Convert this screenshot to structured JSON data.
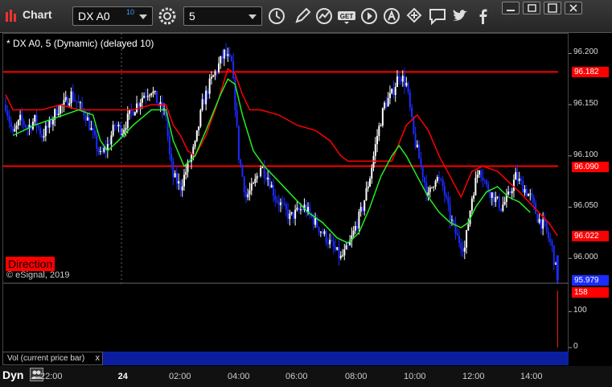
{
  "window": {
    "title": "Chart"
  },
  "toolbar": {
    "symbol": "DX A0",
    "symbol_superscript": "10",
    "interval": "5"
  },
  "chart": {
    "legend": "* DX A0, 5 (Dynamic) (delayed 10)",
    "direction_label": "Direction",
    "copyright": "© eSignal, 2019",
    "price_axis": [
      "96.200",
      "96.150",
      "96.100",
      "96.050",
      "96.000"
    ],
    "price_boxes": [
      {
        "value": "96.182",
        "color": "#ff0000"
      },
      {
        "value": "96.090",
        "color": "#ff0000"
      },
      {
        "value": "96.022",
        "color": "#ff0000"
      },
      {
        "value": "95.979",
        "color": "#1a2cff"
      }
    ],
    "volume_axis": [
      "100",
      "0"
    ],
    "volume_box": "158",
    "volume_label": "Vol (current price bar)",
    "volume_close": "x",
    "time_axis": [
      {
        "label": "22:00",
        "bold": false
      },
      {
        "label": "24",
        "bold": true
      },
      {
        "label": "02:00",
        "bold": false
      },
      {
        "label": "04:00",
        "bold": false
      },
      {
        "label": "06:00",
        "bold": false
      },
      {
        "label": "08:00",
        "bold": false
      },
      {
        "label": "10:00",
        "bold": false
      },
      {
        "label": "12:00",
        "bold": false
      },
      {
        "label": "14:00",
        "bold": false
      }
    ],
    "dyn_label": "Dyn"
  },
  "chart_data": {
    "type": "candlestick",
    "y_range": [
      95.975,
      96.22
    ],
    "levels": [
      96.182,
      96.09
    ],
    "series": [
      {
        "name": "",
        "color": "#ff0000",
        "kind": "line"
      },
      {
        "name": "",
        "color": "#22ee22",
        "kind": "line"
      }
    ],
    "price_path": [
      [
        0,
        96.15
      ],
      [
        4,
        96.12
      ],
      [
        8,
        96.135
      ],
      [
        12,
        96.128
      ],
      [
        16,
        96.135
      ],
      [
        20,
        96.12
      ],
      [
        24,
        96.13
      ],
      [
        28,
        96.145
      ],
      [
        32,
        96.15
      ],
      [
        36,
        96.16
      ],
      [
        40,
        96.15
      ],
      [
        44,
        96.14
      ],
      [
        48,
        96.12
      ],
      [
        52,
        96.1
      ],
      [
        56,
        96.11
      ],
      [
        60,
        96.13
      ],
      [
        64,
        96.125
      ],
      [
        68,
        96.14
      ],
      [
        72,
        96.15
      ],
      [
        76,
        96.16
      ],
      [
        80,
        96.165
      ],
      [
        84,
        96.15
      ],
      [
        88,
        96.14
      ],
      [
        90,
        96.1
      ],
      [
        92,
        96.08
      ],
      [
        96,
        96.07
      ],
      [
        100,
        96.09
      ],
      [
        104,
        96.11
      ],
      [
        108,
        96.15
      ],
      [
        112,
        96.17
      ],
      [
        116,
        96.185
      ],
      [
        120,
        96.2
      ],
      [
        124,
        96.19
      ],
      [
        126,
        96.15
      ],
      [
        128,
        96.1
      ],
      [
        132,
        96.06
      ],
      [
        136,
        96.07
      ],
      [
        140,
        96.09
      ],
      [
        144,
        96.08
      ],
      [
        148,
        96.06
      ],
      [
        152,
        96.05
      ],
      [
        156,
        96.04
      ],
      [
        160,
        96.045
      ],
      [
        164,
        96.05
      ],
      [
        168,
        96.04
      ],
      [
        172,
        96.03
      ],
      [
        176,
        96.02
      ],
      [
        180,
        96.01
      ],
      [
        184,
        96.0
      ],
      [
        188,
        96.01
      ],
      [
        192,
        96.03
      ],
      [
        196,
        96.05
      ],
      [
        200,
        96.08
      ],
      [
        204,
        96.12
      ],
      [
        208,
        96.15
      ],
      [
        212,
        96.16
      ],
      [
        216,
        96.18
      ],
      [
        220,
        96.17
      ],
      [
        224,
        96.12
      ],
      [
        228,
        96.09
      ],
      [
        232,
        96.06
      ],
      [
        236,
        96.08
      ],
      [
        240,
        96.07
      ],
      [
        244,
        96.04
      ],
      [
        248,
        96.02
      ],
      [
        252,
        96.01
      ],
      [
        256,
        96.06
      ],
      [
        260,
        96.09
      ],
      [
        264,
        96.07
      ],
      [
        268,
        96.06
      ],
      [
        272,
        96.05
      ],
      [
        276,
        96.06
      ],
      [
        280,
        96.08
      ],
      [
        284,
        96.07
      ],
      [
        288,
        96.06
      ],
      [
        292,
        96.04
      ],
      [
        296,
        96.03
      ],
      [
        300,
        96.01
      ],
      [
        303,
        95.979
      ]
    ],
    "red_line": [
      [
        0,
        96.16
      ],
      [
        4,
        96.145
      ],
      [
        12,
        96.145
      ],
      [
        20,
        96.145
      ],
      [
        30,
        96.15
      ],
      [
        40,
        96.145
      ],
      [
        50,
        96.145
      ],
      [
        60,
        96.145
      ],
      [
        70,
        96.145
      ],
      [
        80,
        96.15
      ],
      [
        88,
        96.15
      ],
      [
        92,
        96.13
      ],
      [
        96,
        96.12
      ],
      [
        100,
        96.105
      ],
      [
        104,
        96.1
      ],
      [
        110,
        96.12
      ],
      [
        116,
        96.15
      ],
      [
        122,
        96.185
      ],
      [
        126,
        96.18
      ],
      [
        130,
        96.16
      ],
      [
        134,
        96.145
      ],
      [
        140,
        96.145
      ],
      [
        150,
        96.14
      ],
      [
        160,
        96.13
      ],
      [
        170,
        96.125
      ],
      [
        178,
        96.115
      ],
      [
        184,
        96.1
      ],
      [
        188,
        96.095
      ],
      [
        200,
        96.095
      ],
      [
        212,
        96.095
      ],
      [
        220,
        96.13
      ],
      [
        226,
        96.14
      ],
      [
        232,
        96.125
      ],
      [
        238,
        96.1
      ],
      [
        244,
        96.08
      ],
      [
        250,
        96.06
      ],
      [
        256,
        96.085
      ],
      [
        262,
        96.09
      ],
      [
        270,
        96.085
      ],
      [
        276,
        96.075
      ],
      [
        282,
        96.065
      ],
      [
        290,
        96.05
      ],
      [
        298,
        96.035
      ],
      [
        303,
        96.022
      ]
    ],
    "green_line": [
      [
        4,
        96.12
      ],
      [
        10,
        96.125
      ],
      [
        16,
        96.13
      ],
      [
        24,
        96.135
      ],
      [
        32,
        96.14
      ],
      [
        40,
        96.145
      ],
      [
        48,
        96.14
      ],
      [
        52,
        96.115
      ],
      [
        56,
        96.105
      ],
      [
        62,
        96.115
      ],
      [
        70,
        96.13
      ],
      [
        80,
        96.145
      ],
      [
        88,
        96.145
      ],
      [
        92,
        96.115
      ],
      [
        98,
        96.09
      ],
      [
        104,
        96.1
      ],
      [
        110,
        96.125
      ],
      [
        118,
        96.16
      ],
      [
        122,
        96.175
      ],
      [
        126,
        96.17
      ],
      [
        130,
        96.14
      ],
      [
        136,
        96.105
      ],
      [
        142,
        96.09
      ],
      [
        150,
        96.075
      ],
      [
        158,
        96.06
      ],
      [
        166,
        96.045
      ],
      [
        174,
        96.035
      ],
      [
        182,
        96.02
      ],
      [
        188,
        96.015
      ],
      [
        194,
        96.025
      ],
      [
        200,
        96.05
      ],
      [
        206,
        96.08
      ],
      [
        212,
        96.1
      ],
      [
        216,
        96.11
      ],
      [
        220,
        96.1
      ],
      [
        226,
        96.08
      ],
      [
        232,
        96.06
      ],
      [
        238,
        96.045
      ],
      [
        244,
        96.035
      ],
      [
        250,
        96.03
      ],
      [
        254,
        96.035
      ],
      [
        258,
        96.05
      ],
      [
        264,
        96.065
      ],
      [
        270,
        96.07
      ],
      [
        276,
        96.06
      ],
      [
        282,
        96.055
      ],
      [
        288,
        96.045
      ]
    ],
    "volume": {
      "last_bar": 158,
      "y_range": [
        0,
        170
      ]
    }
  }
}
